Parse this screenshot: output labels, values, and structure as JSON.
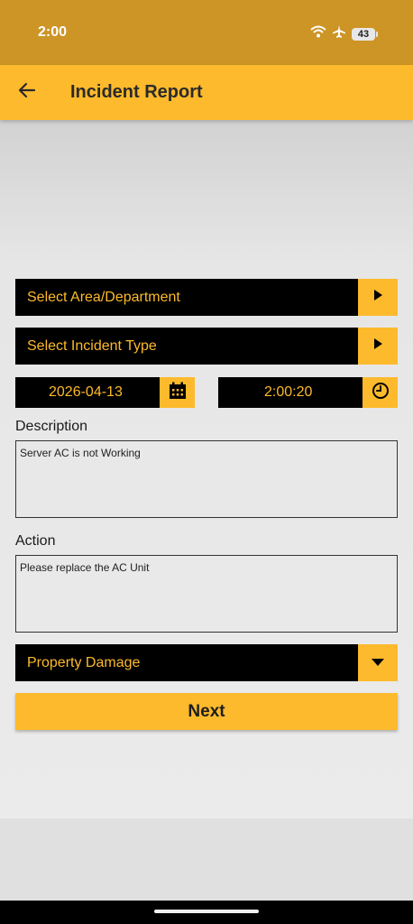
{
  "status_bar": {
    "time": "2:00",
    "battery": "43",
    "icons": [
      "wifi-icon",
      "airplane-icon",
      "battery-icon"
    ]
  },
  "app_bar": {
    "title": "Incident Report",
    "back_icon": "arrow-left-icon"
  },
  "form": {
    "area_select": {
      "label": "Select Area/Department",
      "icon": "play-triangle-icon"
    },
    "incident_type_select": {
      "label": "Select Incident Type",
      "icon": "play-triangle-icon"
    },
    "date": {
      "value": "2026-04-13",
      "icon": "calendar-icon"
    },
    "time": {
      "value": "2:00:20",
      "icon": "clock-icon"
    },
    "description": {
      "label": "Description",
      "value": "Server AC is not Working"
    },
    "action": {
      "label": "Action",
      "value": "Please replace the AC Unit"
    },
    "category_dropdown": {
      "selected": "Property Damage",
      "icon": "caret-down-icon"
    },
    "next_button": {
      "label": "Next"
    }
  },
  "colors": {
    "accent": "#FDBA2C",
    "status_bar": "#CC9526",
    "field_bg": "#000000"
  }
}
